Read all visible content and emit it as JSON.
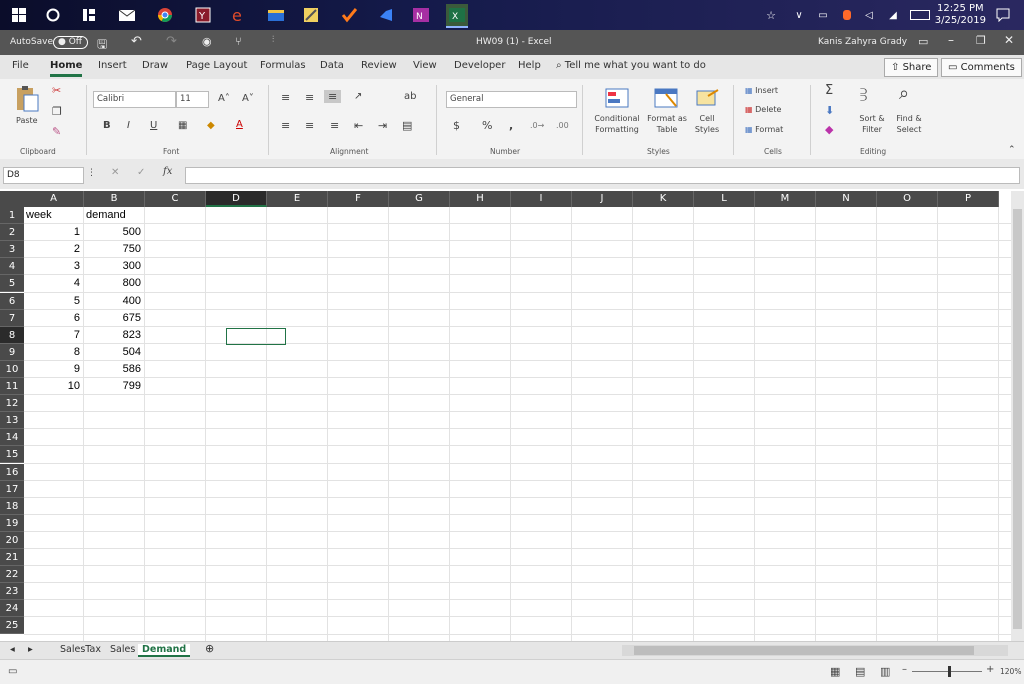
{
  "taskbar": {
    "clock_time": "12:25 PM",
    "clock_date": "3/25/2019",
    "icons": [
      "windows-start-icon",
      "cortana-icon",
      "task-view-icon",
      "mail-icon",
      "chrome-icon",
      "maroon-app-icon",
      "edge-icon",
      "file-explorer-icon",
      "notepad-icon",
      "check-app-icon",
      "vs-icon",
      "onenote-icon",
      "excel-icon"
    ]
  },
  "titlebar": {
    "autosave_label": "AutoSave",
    "autosave_state": "Off",
    "doc_title": "HW09 (1)  -  Excel",
    "user_name": "Kanis Zahyra Grady"
  },
  "ribbon_tabs": [
    "File",
    "Home",
    "Insert",
    "Draw",
    "Page Layout",
    "Formulas",
    "Data",
    "Review",
    "View",
    "Developer",
    "Help"
  ],
  "tell_me": "Tell me what you want to do",
  "share_label": "Share",
  "comments_label": "Comments",
  "ribbon": {
    "clipboard_label": "Clipboard",
    "paste_label": "Paste",
    "font_label": "Font",
    "font_name": "Calibri",
    "font_size": "11",
    "alignment_label": "Alignment",
    "number_label": "Number",
    "number_format": "General",
    "styles_label": "Styles",
    "conditional_formatting": "Conditional Formatting",
    "format_as_table": "Format as Table",
    "cell_styles": "Cell Styles",
    "cells_label": "Cells",
    "insert_label": "Insert",
    "delete_label": "Delete",
    "format_label": "Format",
    "editing_label": "Editing",
    "sort_filter": "Sort & Filter",
    "find_select": "Find & Select"
  },
  "formula_bar": {
    "name_box": "D8",
    "fx_label": "fx",
    "content": ""
  },
  "columns": [
    "A",
    "B",
    "C",
    "D",
    "E",
    "F",
    "G",
    "H",
    "I",
    "J",
    "K",
    "L",
    "M",
    "N",
    "O",
    "P"
  ],
  "selected_column": "D",
  "rows": [
    "1",
    "2",
    "3",
    "4",
    "5",
    "6",
    "7",
    "8",
    "9",
    "10",
    "11",
    "12",
    "13",
    "14",
    "15",
    "16",
    "17",
    "18",
    "19",
    "20",
    "21",
    "22",
    "23",
    "24",
    "25"
  ],
  "selected_row": "8",
  "sheet_data": {
    "header": {
      "a": "week",
      "b": "demand"
    },
    "records": [
      {
        "week": "1",
        "demand": "500"
      },
      {
        "week": "2",
        "demand": "750"
      },
      {
        "week": "3",
        "demand": "300"
      },
      {
        "week": "4",
        "demand": "800"
      },
      {
        "week": "5",
        "demand": "400"
      },
      {
        "week": "6",
        "demand": "675"
      },
      {
        "week": "7",
        "demand": "823"
      },
      {
        "week": "8",
        "demand": "504"
      },
      {
        "week": "9",
        "demand": "586"
      },
      {
        "week": "10",
        "demand": "799"
      }
    ]
  },
  "sheet_tabs": [
    "SalesTax",
    "Sales",
    "Demand"
  ],
  "active_sheet": "Demand",
  "status": {
    "zoom": "120%"
  },
  "colors": {
    "accent": "#217346",
    "taskbar": "#141a4a"
  }
}
